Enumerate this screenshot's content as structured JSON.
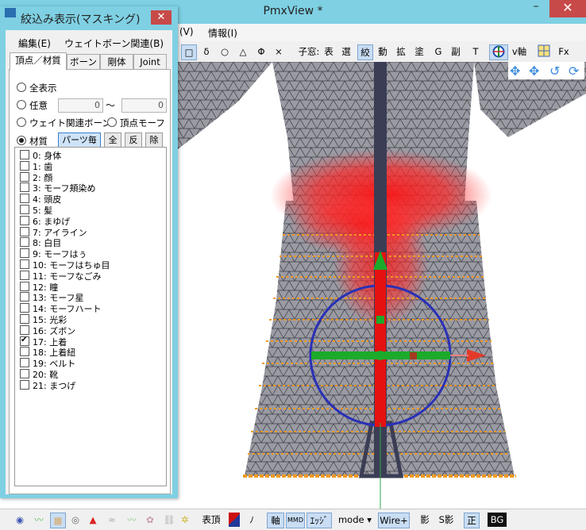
{
  "main": {
    "title": "PmxView *",
    "menu": [
      {
        "label": "(V)"
      },
      {
        "label": "情報(I)"
      }
    ],
    "toolbar_left": [
      {
        "label": "□",
        "on": true
      },
      {
        "label": "δ"
      },
      {
        "label": "○"
      },
      {
        "label": "△"
      },
      {
        "label": "Φ"
      },
      {
        "label": "×"
      }
    ],
    "toolbar_prefix": "子窓:",
    "toolbar_right": [
      {
        "label": "表"
      },
      {
        "label": "選"
      },
      {
        "label": "絞",
        "on": true
      },
      {
        "label": "動"
      },
      {
        "label": "拡"
      },
      {
        "label": "塗"
      },
      {
        "label": "G"
      },
      {
        "label": "副"
      },
      {
        "label": "T"
      }
    ],
    "axis_label": "v軸",
    "fx_label": "Fx"
  },
  "bottom": {
    "vertex_label": "表頂",
    "no_label": "ﾉ",
    "axis": "軸",
    "mmd": "MMD",
    "edge": "ｴｯｼﾞ",
    "mode": "mode",
    "wire": "Wire+",
    "shadow": "影",
    "sshadow": "S影",
    "correct": "正",
    "bg": "BG"
  },
  "mask": {
    "title": "絞込み表示(マスキング)",
    "menu": [
      {
        "label": "編集(E)"
      },
      {
        "label": "ウェイトボーン関連(B)"
      }
    ],
    "tabs": [
      {
        "label": "頂点／材質"
      },
      {
        "label": "ボーン"
      },
      {
        "label": "剛体"
      },
      {
        "label": "Joint"
      }
    ],
    "radio_all": "全表示",
    "radio_any": "任意",
    "range_from": "0",
    "range_sep": "～",
    "range_to": "0",
    "radio_weight": "ウェイト関連ボーン",
    "radio_morph": "頂点モーフ",
    "radio_material": "材質",
    "btn_parts": "パーツ毎",
    "btn_all": "全",
    "btn_invert": "反",
    "btn_remove": "除",
    "materials": [
      {
        "label": "0: 身体",
        "checked": false
      },
      {
        "label": "1: 歯",
        "checked": false
      },
      {
        "label": "2: 顔",
        "checked": false
      },
      {
        "label": "3: モーフ頬染め",
        "checked": false
      },
      {
        "label": "4: 頭皮",
        "checked": false
      },
      {
        "label": "5: 髪",
        "checked": false
      },
      {
        "label": "6: まゆげ",
        "checked": false
      },
      {
        "label": "7: アイライン",
        "checked": false
      },
      {
        "label": "8: 白目",
        "checked": false
      },
      {
        "label": "9: モーフはぅ",
        "checked": false
      },
      {
        "label": "10: モーフはちゅ目",
        "checked": false
      },
      {
        "label": "11: モーフなごみ",
        "checked": false
      },
      {
        "label": "12: 瞳",
        "checked": false
      },
      {
        "label": "13: モーフ星",
        "checked": false
      },
      {
        "label": "14: モーフハート",
        "checked": false
      },
      {
        "label": "15: 光彩",
        "checked": false
      },
      {
        "label": "16: ズボン",
        "checked": false
      },
      {
        "label": "17: 上着",
        "checked": true
      },
      {
        "label": "18: 上着紐",
        "checked": false
      },
      {
        "label": "19: ベルト",
        "checked": false
      },
      {
        "label": "20: 靴",
        "checked": false
      },
      {
        "label": "21: まつげ",
        "checked": false
      }
    ]
  }
}
